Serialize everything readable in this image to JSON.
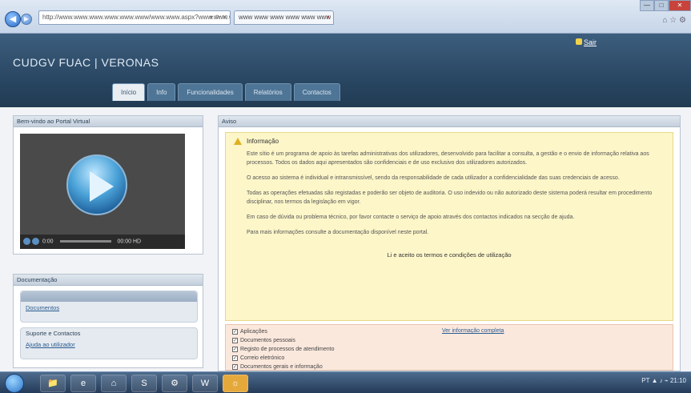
{
  "browser": {
    "address": "http://www.www.www.www.www.www/www.www.aspx?www.www.www",
    "tab_title": "www www www www www www",
    "close_glyph": "×",
    "minimize_glyph": "—",
    "maximize_glyph": "□",
    "close_win_glyph": "✕",
    "back_glyph": "◀",
    "forward_glyph": "▶",
    "address_icons": "▾ ⟳ ✕",
    "tool_icons": "⌂ ☆ ⚙"
  },
  "header": {
    "title": "CUDGV FUAC | VERONAS",
    "logout": "Sair"
  },
  "main_tabs": [
    {
      "label": "Início",
      "active": true
    },
    {
      "label": "Info"
    },
    {
      "label": "Funcionalidades"
    },
    {
      "label": "Relatórios"
    },
    {
      "label": "Contactos"
    }
  ],
  "video_panel": {
    "title": "Bem-vindo ao Portal Virtual",
    "time": "0:00",
    "duration": "00:00",
    "hd": "HD"
  },
  "side_panel": {
    "title": "Documentação",
    "group1_link": "Documentos",
    "group2_title": "Suporte e Contactos",
    "group2_link": "Ajuda ao utilizador"
  },
  "notice": {
    "panel_title": "Aviso",
    "title": "Informação",
    "paragraphs": [
      "Este sítio é um programa de apoio às tarefas administrativas dos utilizadores, desenvolvido para facilitar a consulta, a gestão e o envio de informação relativa aos processos. Todos os dados aqui apresentados são confidenciais e de uso exclusivo dos utilizadores autorizados.",
      "O acesso ao sistema é individual e intransmissível, sendo da responsabilidade de cada utilizador a confidencialidade das suas credenciais de acesso.",
      "Todas as operações efetuadas são registadas e poderão ser objeto de auditoria. O uso indevido ou não autorizado deste sistema poderá resultar em procedimento disciplinar, nos termos da legislação em vigor.",
      "Em caso de dúvida ou problema técnico, por favor contacte o serviço de apoio através dos contactos indicados na secção de ajuda.",
      "Para mais informações consulte a documentação disponível neste portal."
    ],
    "footer": "Li e aceito os termos e condições de utilização"
  },
  "options": {
    "link": "Ver informação completa",
    "items": [
      {
        "label": "Aplicações",
        "checked": true
      },
      {
        "label": "Documentos pessoais",
        "checked": true
      },
      {
        "label": "Registo de processos de atendimento",
        "checked": true
      },
      {
        "label": "Correio eletrónico",
        "checked": true
      },
      {
        "label": "Documentos gerais e informação",
        "checked": true
      }
    ]
  },
  "taskbar": {
    "items": [
      "📁",
      "e",
      "⌂",
      "S",
      "⚙",
      "W",
      "☼"
    ],
    "tray": "PT  ▲ ♪ ⌁  21:10"
  }
}
